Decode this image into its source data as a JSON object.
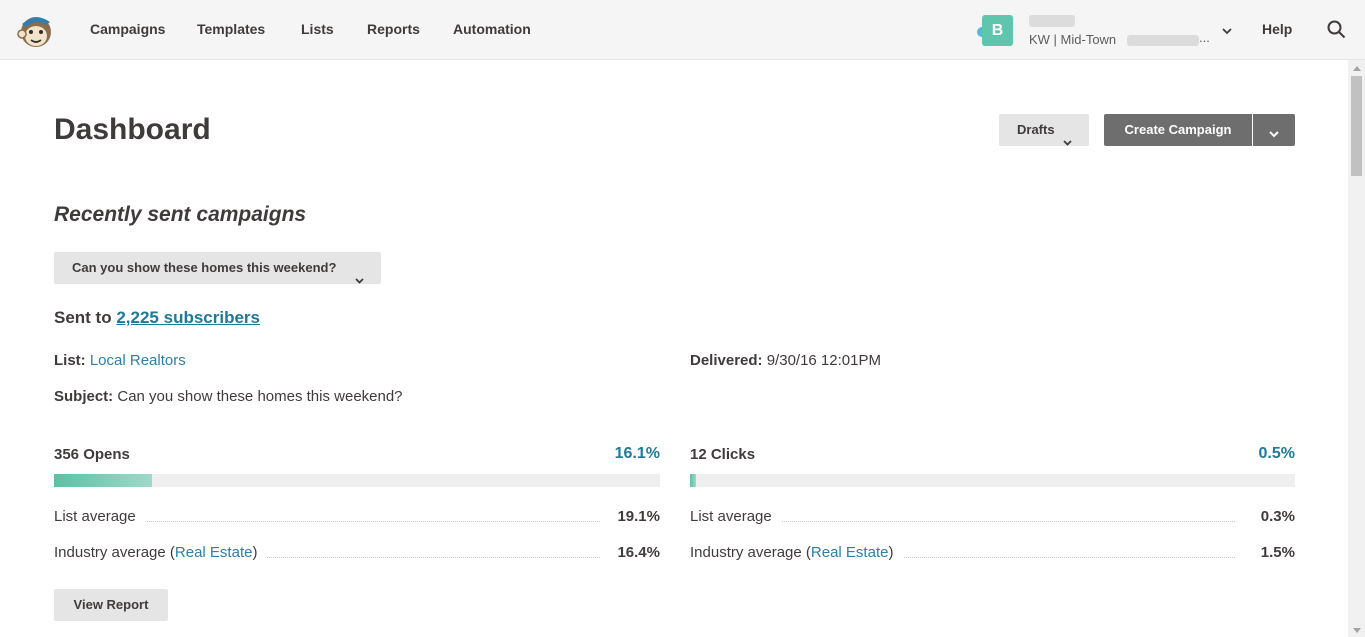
{
  "nav": {
    "items": [
      {
        "label": "Campaigns"
      },
      {
        "label": "Templates"
      },
      {
        "label": "Lists"
      },
      {
        "label": "Reports"
      },
      {
        "label": "Automation"
      }
    ],
    "help_label": "Help",
    "account": {
      "avatar_letter": "B",
      "name": "KW | Mid-Town",
      "ellipsis": "..."
    }
  },
  "page": {
    "title": "Dashboard",
    "drafts_label": "Drafts",
    "create_label": "Create Campaign"
  },
  "recent": {
    "section_title": "Recently sent campaigns",
    "selected_campaign": "Can you show these homes this weekend?",
    "sent_prefix": "Sent to",
    "sent_link": "2,225 subscribers",
    "list_label": "List:",
    "list_value": "Local Realtors",
    "delivered_label": "Delivered:",
    "delivered_value": "9/30/16 12:01PM",
    "subject_label": "Subject:",
    "subject_value": "Can you show these homes this weekend?"
  },
  "opens": {
    "title": "356 Opens",
    "rate": "16.1%",
    "rate_fraction": 0.161,
    "list_avg_label": "List average",
    "list_avg_value": "19.1%",
    "industry_label_prefix": "Industry average (",
    "industry_link": "Real Estate",
    "industry_label_suffix": ")",
    "industry_value": "16.4%"
  },
  "clicks": {
    "title": "12 Clicks",
    "rate": "0.5%",
    "rate_fraction": 0.005,
    "list_avg_label": "List average",
    "list_avg_value": "0.3%",
    "industry_label_prefix": "Industry average (",
    "industry_link": "Real Estate",
    "industry_label_suffix": ")",
    "industry_value": "1.5%"
  },
  "actions": {
    "view_report_label": "View Report"
  },
  "colors": {
    "accent": "#1f7a9a",
    "bar_fill": "#5cc0a6",
    "button_dark": "#6d6e6d"
  }
}
